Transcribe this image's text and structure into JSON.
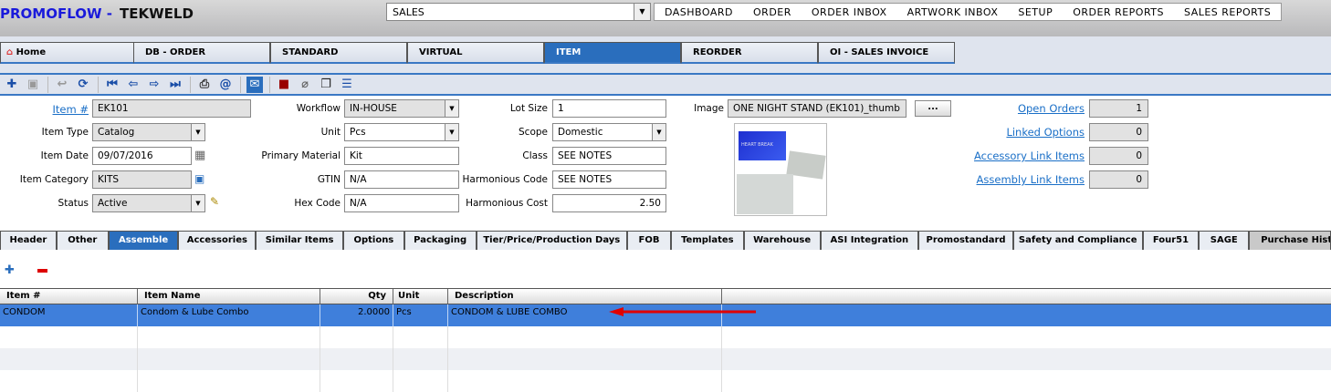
{
  "app": {
    "brand": "PROMOFLOW -",
    "company": "TEKWELD",
    "module": "SALES",
    "menu": [
      "DASHBOARD",
      "ORDER",
      "ORDER INBOX",
      "ARTWORK INBOX",
      "SETUP",
      "ORDER REPORTS",
      "SALES REPORTS"
    ]
  },
  "main_tabs": [
    "Home",
    "DB - ORDER",
    "STANDARD",
    "VIRTUAL",
    "ITEM",
    "REORDER",
    "OI - SALES INVOICE"
  ],
  "active_tab": "ITEM",
  "form": {
    "item_no": {
      "label": "Item #",
      "value": "EK101"
    },
    "item_type": {
      "label": "Item Type",
      "value": "Catalog"
    },
    "item_date": {
      "label": "Item Date",
      "value": "09/07/2016"
    },
    "item_category": {
      "label": "Item Category",
      "value": "KITS"
    },
    "status": {
      "label": "Status",
      "value": "Active"
    },
    "workflow": {
      "label": "Workflow",
      "value": "IN-HOUSE"
    },
    "unit": {
      "label": "Unit",
      "value": "Pcs"
    },
    "primary_material": {
      "label": "Primary Material",
      "value": "Kit"
    },
    "gtin": {
      "label": "GTIN",
      "value": "N/A"
    },
    "hex_code": {
      "label": "Hex Code",
      "value": "N/A"
    },
    "lot_size": {
      "label": "Lot Size",
      "value": "1"
    },
    "scope": {
      "label": "Scope",
      "value": "Domestic"
    },
    "class": {
      "label": "Class",
      "value": "SEE NOTES"
    },
    "harmonious_code": {
      "label": "Harmonious Code",
      "value": "SEE NOTES"
    },
    "harmonious_cost": {
      "label": "Harmonious Cost",
      "value": "2.50"
    },
    "image": {
      "label": "Image",
      "value": "ONE NIGHT STAND (EK101)_thumb",
      "browse": "...",
      "thumb_text": "HEART BREAK"
    }
  },
  "links": [
    {
      "label": "Open Orders",
      "value": "1"
    },
    {
      "label": "Linked Options",
      "value": "0"
    },
    {
      "label": "Accessory Link Items",
      "value": "0"
    },
    {
      "label": "Assembly Link Items",
      "value": "0"
    }
  ],
  "sub_tabs": [
    "Header",
    "Other",
    "Assemble",
    "Accessories",
    "Similar Items",
    "Options",
    "Packaging",
    "Tier/Price/Production Days",
    "FOB",
    "Templates",
    "Warehouse",
    "ASI Integration",
    "Promostandard",
    "Safety and Compliance",
    "Four51",
    "SAGE",
    "Purchase History"
  ],
  "grid": {
    "columns": [
      "Item #",
      "Item Name",
      "Qty",
      "Unit",
      "Description"
    ],
    "rows": [
      {
        "item_no": "CONDOM",
        "item_name": "Condom & Lube Combo",
        "qty": "2.0000",
        "unit": "Pcs",
        "description": "CONDOM & LUBE COMBO"
      }
    ]
  },
  "colors": {
    "accent": "#2a6ebd",
    "selected_row": "#3f7fdb",
    "annotation_arrow": "#e00000"
  }
}
